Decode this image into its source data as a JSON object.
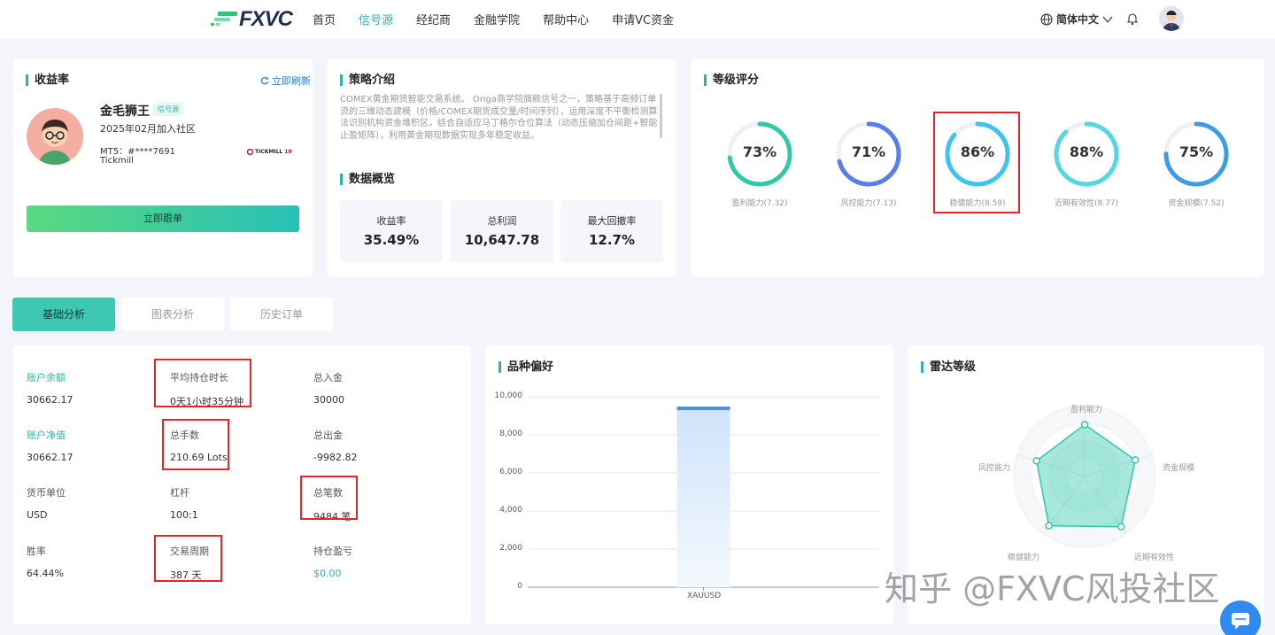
{
  "nav": {
    "logo": "FXVC",
    "items": [
      "首页",
      "信号源",
      "经纪商",
      "金融学院",
      "帮助中心",
      "申请VC资金"
    ],
    "active_index": 1,
    "language": "简体中文"
  },
  "profile": {
    "title": "收益率",
    "refresh": "立即刷新",
    "name": "金毛狮王",
    "badge": "信号源",
    "joined": "2025年02月加入社区",
    "mt5": "MT5：#****7691",
    "broker": "Tickmill",
    "broker_logo": "TICKMILL",
    "broker_logo_num": "10",
    "follow_button": "立即跟单"
  },
  "strategy": {
    "title": "策略介绍",
    "text": "COMEX黄金期货智能交易系统。 Origa商学院旗舰信号之一，策略基于高频订单流的三维动态建模（价格/COMEX期货成交量/时间序列），运用深度不平衡检测算法识别机构资金堆积区，结合自适应马丁格尔仓位算法（动态压缩加仓间距+智能止盈矩阵），利用黄金期现数据实现多年稳定收益。",
    "overview_title": "数据概览",
    "stats": [
      {
        "label": "收益率",
        "value": "35.49%"
      },
      {
        "label": "总利润",
        "value": "10,647.78"
      },
      {
        "label": "最大回撤率",
        "value": "12.7%"
      }
    ]
  },
  "rating": {
    "title": "等级评分",
    "gauges": [
      {
        "percent": "73%",
        "label": "盈利能力(7.32)",
        "fraction": 0.73,
        "color": "#2fcaa3"
      },
      {
        "percent": "71%",
        "label": "风控能力(7.13)",
        "fraction": 0.71,
        "color": "#5b7cf0"
      },
      {
        "percent": "86%",
        "label": "稳健能力(8.59)",
        "fraction": 0.86,
        "color": "#3fc3f0"
      },
      {
        "percent": "88%",
        "label": "近期有效性(8.77)",
        "fraction": 0.88,
        "color": "#55d6e0"
      },
      {
        "percent": "75%",
        "label": "资金规模(7.52)",
        "fraction": 0.75,
        "color": "#3b9de8"
      }
    ]
  },
  "tabs": [
    "基础分析",
    "图表分析",
    "历史订单"
  ],
  "basic": {
    "fields": [
      {
        "label": "账户余额",
        "value": "30662.17",
        "highlight_label": true
      },
      {
        "label": "平均持仓时长",
        "value": "0天1小时35分钟"
      },
      {
        "label": "总入金",
        "value": "30000"
      },
      {
        "label": "账户净值",
        "value": "30662.17",
        "highlight_label": true
      },
      {
        "label": "总手数",
        "value": "210.69 Lots"
      },
      {
        "label": "总出金",
        "value": "-9982.82"
      },
      {
        "label": "货币单位",
        "value": "USD"
      },
      {
        "label": "杠杆",
        "value": "100:1"
      },
      {
        "label": "总笔数",
        "value": "9484 笔"
      },
      {
        "label": "胜率",
        "value": "64.44%"
      },
      {
        "label": "交易周期",
        "value": "387 天"
      },
      {
        "label": "持仓盈亏",
        "value": "$0.00",
        "green_value": true
      }
    ]
  },
  "variety": {
    "title": "品种偏好",
    "chart_data": {
      "type": "bar",
      "categories": [
        "XAUUSD"
      ],
      "values": [
        9484
      ],
      "ylim": [
        0,
        10000
      ],
      "yticks": [
        "10,000",
        "8,000",
        "6,000",
        "4,000",
        "2,000",
        "0"
      ],
      "grid": true
    }
  },
  "radar": {
    "title": "雷达等级",
    "axes": [
      "盈利能力",
      "资金规模",
      "近期有效性",
      "稳健能力",
      "风控能力"
    ],
    "values": [
      7.32,
      7.52,
      8.77,
      8.59,
      7.13
    ],
    "max": 10
  },
  "watermark": "知乎 @FXVC风投社区"
}
